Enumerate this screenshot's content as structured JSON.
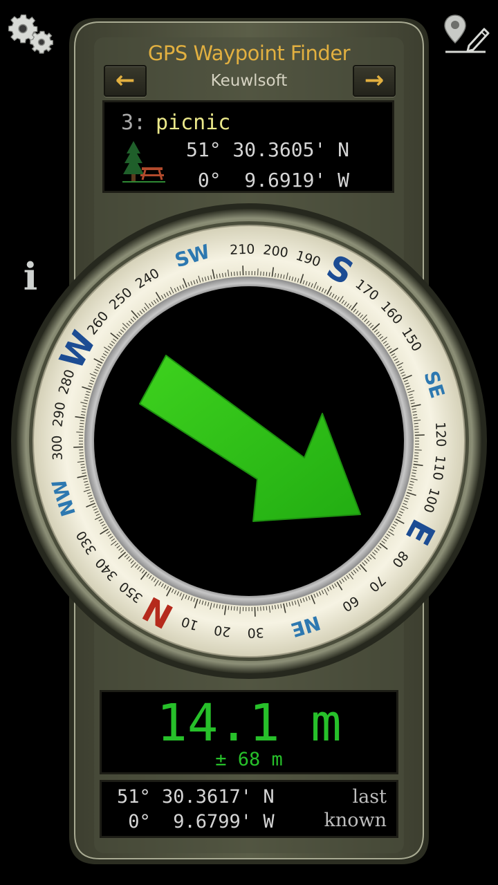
{
  "header": {
    "title": "GPS Waypoint Finder",
    "subtitle": "Keuwlsoft",
    "prev_label": "←",
    "next_label": "→"
  },
  "toolbar": {
    "settings_icon": "gears-icon",
    "edit_waypoint_icon": "map-pin-pencil-icon",
    "info_label": "i"
  },
  "waypoint": {
    "index": "3:",
    "name": "picnic",
    "icon": "tree-picnic-table-icon",
    "latitude": "51° 30.3605' N",
    "longitude": " 0°  9.6919' W"
  },
  "compass": {
    "rotation_deg": 0,
    "arrow_color": "#2fc217",
    "cardinals": [
      {
        "label": "N",
        "bearing": 0,
        "color": "#b52a1c"
      },
      {
        "label": "E",
        "bearing": 90,
        "color": "#1c4c93"
      },
      {
        "label": "S",
        "bearing": 180,
        "color": "#1c4c93"
      },
      {
        "label": "W",
        "bearing": 270,
        "color": "#1c4c93"
      }
    ],
    "intercardinals": [
      {
        "label": "NE",
        "bearing": 45,
        "color": "#2d78b0"
      },
      {
        "label": "SE",
        "bearing": 135,
        "color": "#2d78b0"
      },
      {
        "label": "SW",
        "bearing": 225,
        "color": "#2d78b0"
      },
      {
        "label": "NW",
        "bearing": 315,
        "color": "#2d78b0"
      }
    ],
    "degree_labels": [
      "10",
      "20",
      "30",
      "60",
      "70",
      "80",
      "100",
      "110",
      "120",
      "150",
      "160",
      "170",
      "190",
      "200",
      "210",
      "240",
      "250",
      "260",
      "280",
      "290",
      "300",
      "330",
      "340",
      "350"
    ]
  },
  "distance": {
    "value": "14.1 m",
    "accuracy": "± 68 m"
  },
  "current_location": {
    "latitude": "51° 30.3617' N",
    "longitude": " 0°  9.6799' W",
    "status_line1": "last",
    "status_line2": "known"
  },
  "colors": {
    "title": "#e2b040",
    "distance": "#27c02a",
    "device_body": "#555843",
    "bezel": "#f2eedb"
  }
}
